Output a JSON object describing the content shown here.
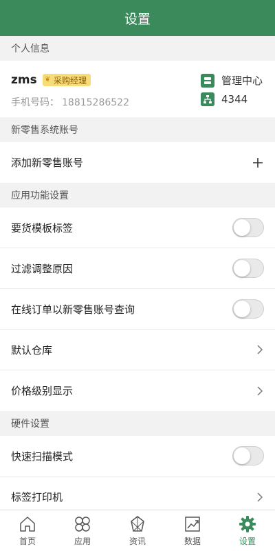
{
  "header": {
    "title": "设置"
  },
  "sections": {
    "personal": "个人信息",
    "retail": "新零售系统账号",
    "app": "应用功能设置",
    "hardware": "硬件设置"
  },
  "profile": {
    "name": "zms",
    "role": "采购经理",
    "phone_label": "手机号码：",
    "phone": "18815286522",
    "mgmt_center": "管理中心",
    "code": "4344"
  },
  "retail": {
    "add_label": "添加新零售账号"
  },
  "settings": {
    "template_tag": "要货模板标签",
    "filter_reason": "过滤调整原因",
    "online_order": "在线订单以新零售账号查询",
    "default_warehouse": "默认仓库",
    "price_level": "价格级别显示"
  },
  "toggles": {
    "template_tag": false,
    "filter_reason": false,
    "online_order": false,
    "quick_scan": false
  },
  "hardware": {
    "quick_scan": "快速扫描模式",
    "label_printer": "标签打印机"
  },
  "tabbar": {
    "home": "首页",
    "apps": "应用",
    "news": "资讯",
    "data": "数据",
    "settings": "设置",
    "active": "settings"
  },
  "colors": {
    "brand": "#3a8a5c",
    "role_badge": "#f7dc7a"
  }
}
